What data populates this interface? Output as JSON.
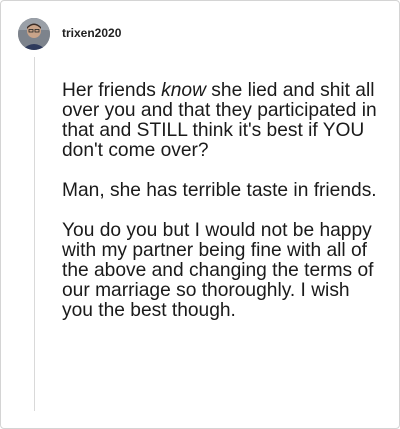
{
  "comment": {
    "username": "trixen2020",
    "avatar_icon": "user-avatar-photo",
    "paragraph1": {
      "before": "Her friends ",
      "emphasis": "know",
      "after": " she lied and shit all over you and that they participated in that and STILL think it's best if YOU don't come over?"
    },
    "paragraph2": "Man, she has terrible taste in friends.",
    "paragraph3": "You do you but I would not be happy with my partner being fine with all of the above and changing the terms of our marriage so thoroughly. I wish you the best though."
  },
  "colors": {
    "text": "#1a1a1a",
    "username": "#222222",
    "border": "#d4d4d4",
    "thread_line": "#d9d9d9"
  }
}
